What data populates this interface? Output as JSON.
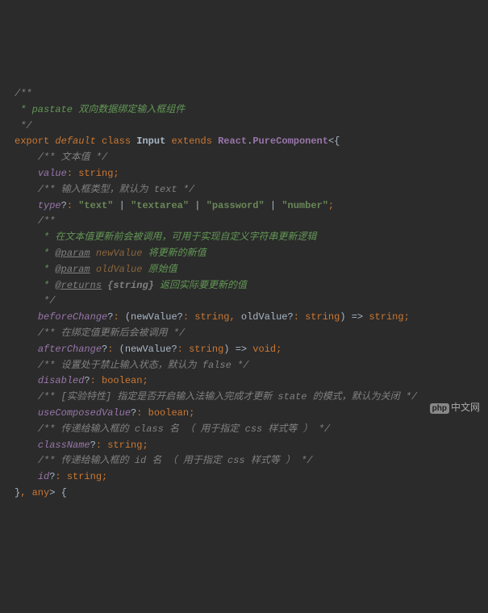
{
  "code": {
    "l1_open": "/**",
    "l2_text": " * pastate 双向数据绑定输入框组件",
    "l3_close": " */",
    "l4_export": "export",
    "l4_default": "default",
    "l4_class": "class",
    "l4_name": "Input",
    "l4_extends": "extends",
    "l4_react": "React",
    "l4_dot": ".",
    "l4_pure": "PureComponent",
    "l5_comment": "/** 文本值 */",
    "l6_prop": "value",
    "l6_type": "string",
    "l7_comment": "/** 输入框类型，默认为 text */",
    "l8_prop": "type",
    "l8_s1": "\"text\"",
    "l8_s2": "\"textarea\"",
    "l8_s3": "\"password\"",
    "l8_s4": "\"number\"",
    "l9_open": "/**",
    "l10": " * 在文本值更新前会被调用，可用于实现自定义字符串更新逻辑",
    "l11_tag": "@param",
    "l11_name": "newValue",
    "l11_desc": "将更新的新值",
    "l12_tag": "@param",
    "l12_name": "oldValue",
    "l12_desc": "原始值",
    "l13_tag": "@returns",
    "l13_type": "{string}",
    "l13_desc": "返回实际要更新的值",
    "l14_close": " */",
    "l15_prop": "beforeChange",
    "l15_p1": "newValue",
    "l15_t1": "string",
    "l15_p2": "oldValue",
    "l15_t2": "string",
    "l15_ret": "string",
    "l16_comment": "/** 在绑定值更新后会被调用 */",
    "l17_prop": "afterChange",
    "l17_p1": "newValue",
    "l17_t1": "string",
    "l17_ret": "void",
    "l18_comment": "/** 设置处于禁止输入状态，默认为 false */",
    "l19_prop": "disabled",
    "l19_type": "boolean",
    "l20_comment": "/** [实验特性] 指定是否开启输入法输入完成才更新 state 的模式，默认为关闭 */",
    "l21_prop": "useComposedValue",
    "l21_type": "boolean",
    "l22_comment": "/** 传递给输入框的 class 名 （ 用于指定 css 样式等 ） */",
    "l23_prop": "className",
    "l23_type": "string",
    "l24_comment": "/** 传递给输入框的 id 名 （ 用于指定 css 样式等 ） */",
    "l25_prop": "id",
    "l25_type": "string",
    "l26_any": "any"
  },
  "watermark": {
    "badge": "php",
    "text": "中文网"
  }
}
